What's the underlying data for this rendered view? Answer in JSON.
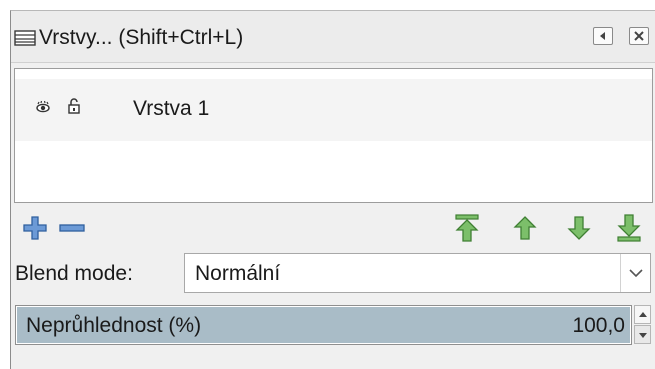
{
  "window": {
    "title": "Vrstvy... (Shift+Ctrl+L)",
    "buttons": [
      "collapse-icon",
      "close-icon"
    ]
  },
  "layers": {
    "items": [
      {
        "name": "Vrstva 1",
        "visible": true,
        "locked": false,
        "icons": [
          "eye-icon",
          "lock-icon"
        ]
      }
    ]
  },
  "toolbar": {
    "icons": [
      "add-layer-icon",
      "remove-layer-icon",
      "raise-to-top-icon",
      "raise-icon",
      "lower-icon",
      "lower-to-bottom-icon"
    ],
    "colors": {
      "add_remove": "#4a7bbf",
      "arrows": "#5aa05a"
    }
  },
  "blend": {
    "label": "Blend mode:",
    "value": "Normální"
  },
  "opacity": {
    "label": "Neprůhlednost (%)",
    "value": "100,0",
    "fill_percent": 100
  }
}
